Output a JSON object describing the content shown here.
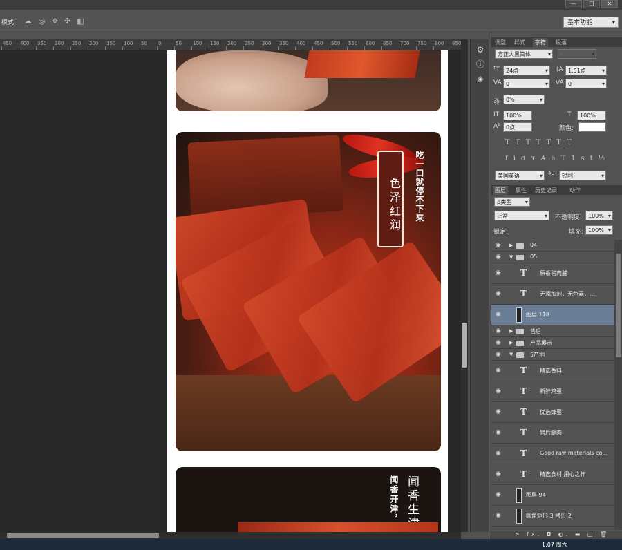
{
  "window": {
    "minimize": "—",
    "restore": "❐",
    "close": "✕"
  },
  "options_bar": {
    "mode_label": "模式:",
    "workspace": "基本功能"
  },
  "ruler": {
    "labels": [
      "450",
      "400",
      "350",
      "300",
      "250",
      "200",
      "150",
      "100",
      "50",
      "0",
      "50",
      "100",
      "150",
      "200",
      "250",
      "300",
      "350",
      "400",
      "450",
      "500",
      "550",
      "600",
      "650",
      "700",
      "750",
      "800",
      "850"
    ]
  },
  "canvas": {
    "card2": {
      "title": "色泽红润",
      "tagline": "吃一口就停不下来"
    },
    "card3": {
      "title": "闻香生津",
      "subtitle": "闻香开津，"
    }
  },
  "char_panel": {
    "tabs": [
      "调整",
      "样式",
      "字符",
      "段落"
    ],
    "active_tab": "字符",
    "font_family": "方正大黑简体",
    "font_style": "-",
    "font_size": "24点",
    "leading": "1.51点",
    "kerning": "0",
    "tracking": "0",
    "scale_pct": "0%",
    "vertical_scale": "100%",
    "horizontal_scale": "100%",
    "baseline_shift": "0点",
    "color_label": "颜色:",
    "language": "美国英语",
    "aa_label": "ªa",
    "antialias": "锐利",
    "glyph_row1": "TTTTTTT",
    "glyph_row2": "fiστAaT1st½"
  },
  "layers_panel": {
    "tabs": [
      "图层",
      "属性",
      "历史记录",
      "动作"
    ],
    "active_tab": "图层",
    "filter": "ρ类型",
    "blend_mode": "正常",
    "opacity_label": "不透明度:",
    "opacity": "100%",
    "lock_label": "锁定:",
    "fill_label": "填充:",
    "fill": "100%",
    "layers": [
      {
        "kind": "folder-closed",
        "name": "04"
      },
      {
        "kind": "folder-open",
        "name": "05"
      },
      {
        "kind": "text",
        "name": "原香猪肉脯"
      },
      {
        "kind": "text",
        "name": "无添加剂，无色素，…"
      },
      {
        "kind": "image",
        "name": "图层 118",
        "selected": true
      },
      {
        "kind": "folder-closed",
        "name": "售后"
      },
      {
        "kind": "folder-closed",
        "name": "产品展示"
      },
      {
        "kind": "folder-open",
        "name": "5产地"
      },
      {
        "kind": "text",
        "name": "精选香料"
      },
      {
        "kind": "text",
        "name": "新鲜鸡蛋"
      },
      {
        "kind": "text",
        "name": "优选蜂蜜"
      },
      {
        "kind": "text",
        "name": "猪后腿肉"
      },
      {
        "kind": "text",
        "name": "Good raw materials co…"
      },
      {
        "kind": "text",
        "name": "精选食材 用心之作"
      },
      {
        "kind": "image",
        "name": "图层 94"
      },
      {
        "kind": "shape",
        "name": "圆角矩形 3 拷贝 2"
      }
    ],
    "footer": "∞  fx.  ◘  ◐.  ▬  ◫  🗑"
  },
  "taskbar": {
    "clock": "1:07 周六"
  }
}
